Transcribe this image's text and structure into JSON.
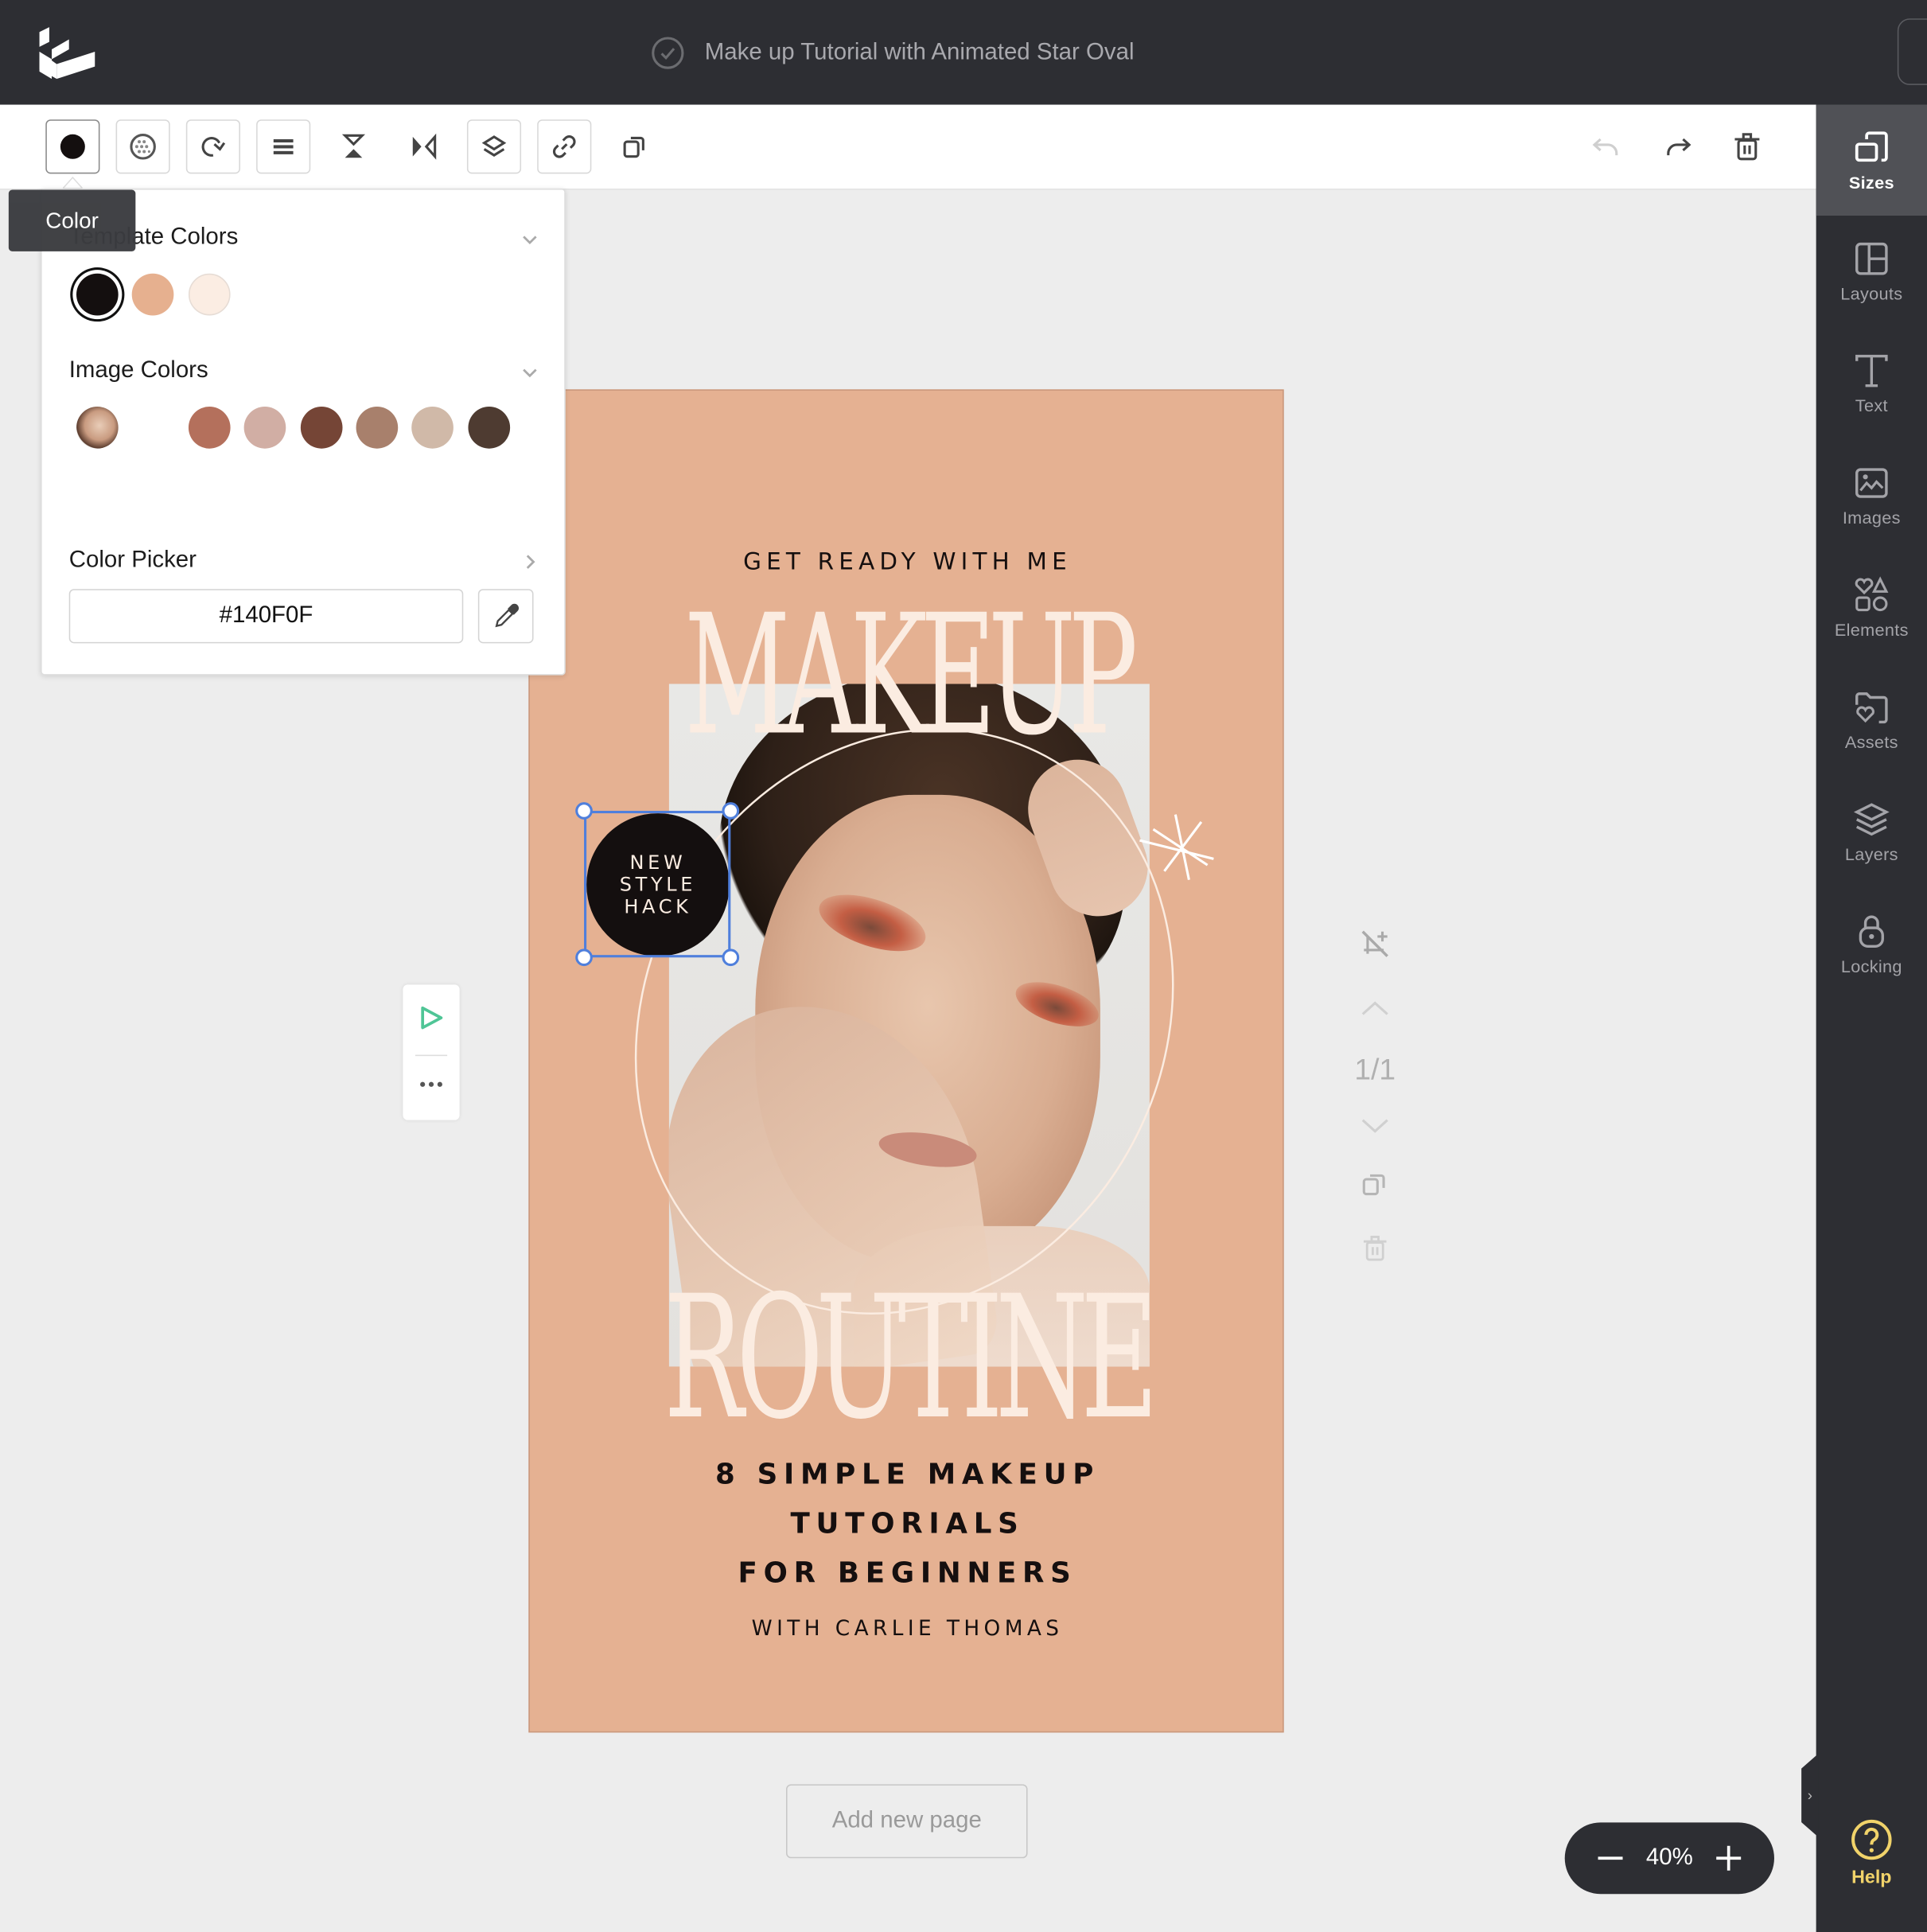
{
  "app": {
    "document_title": "Make up Tutorial with Animated Star Oval",
    "save_status_icon": "check-circle-icon",
    "logo": "app-logo"
  },
  "toolbar": {
    "left_tools": [
      {
        "name": "color",
        "icon": "filled-circle-icon",
        "active": true
      },
      {
        "name": "transparency",
        "icon": "checker-circle-icon"
      },
      {
        "name": "rotate",
        "icon": "rotate-icon"
      },
      {
        "name": "align",
        "icon": "align-lines-icon"
      },
      {
        "name": "flip-vertical",
        "icon": "flip-vertical-icon"
      },
      {
        "name": "flip-horizontal",
        "icon": "flip-horizontal-icon"
      },
      {
        "name": "layer-order",
        "icon": "layers-icon"
      },
      {
        "name": "link",
        "icon": "link-icon"
      },
      {
        "name": "duplicate",
        "icon": "duplicate-icon"
      }
    ],
    "right_tools": [
      {
        "name": "undo",
        "icon": "undo-icon",
        "disabled": true
      },
      {
        "name": "redo",
        "icon": "redo-icon"
      },
      {
        "name": "delete",
        "icon": "trash-icon"
      }
    ],
    "tooltip": "Color"
  },
  "color_panel": {
    "template_colors_label": "Template Colors",
    "template_colors": [
      "#140F0F",
      "#E6B08F",
      "#FBEDE3"
    ],
    "selected_color": "#140F0F",
    "image_colors_label": "Image Colors",
    "image_colors": [
      "#B4705C",
      "#D1AEA4",
      "#754536",
      "#A8806C",
      "#D0B9A8",
      "#4E3B31"
    ],
    "color_picker_label": "Color Picker",
    "hex_value": "#140F0F",
    "eyedropper_icon": "eyedropper-icon"
  },
  "design": {
    "background": "#E5B192",
    "kicker": "GET READY WITH ME",
    "headline_top": "MAKEUP",
    "headline_bottom": "ROUTINE",
    "badge_lines": [
      "NEW",
      "STYLE",
      "HACK"
    ],
    "subtitle_lines": [
      "8 SIMPLE MAKEUP",
      "TUTORIALS",
      "FOR BEGINNERS"
    ],
    "author": "WITH CARLIE THOMAS"
  },
  "page_controls": {
    "page_indicator": "1/1"
  },
  "add_page_label": "Add new page",
  "zoom": {
    "level": "40%"
  },
  "sidebar": {
    "items": [
      {
        "label": "Sizes",
        "icon": "resize-icon",
        "active": true
      },
      {
        "label": "Layouts",
        "icon": "layout-icon"
      },
      {
        "label": "Text",
        "icon": "text-icon"
      },
      {
        "label": "Images",
        "icon": "image-icon"
      },
      {
        "label": "Elements",
        "icon": "shapes-icon"
      },
      {
        "label": "Assets",
        "icon": "folder-heart-icon"
      },
      {
        "label": "Layers",
        "icon": "layers-icon"
      },
      {
        "label": "Locking",
        "icon": "lock-icon"
      }
    ],
    "help_label": "Help"
  }
}
